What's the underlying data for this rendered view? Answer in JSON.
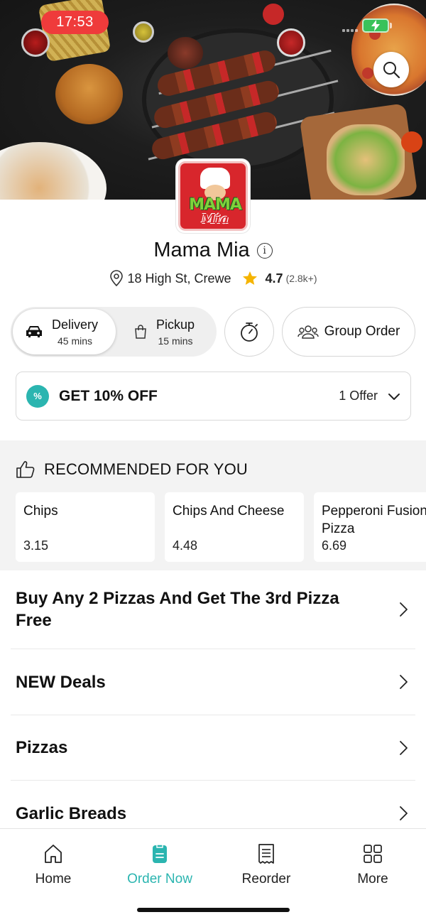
{
  "status_bar": {
    "time": "17:53"
  },
  "restaurant": {
    "name": "Mama Mia",
    "logo_text_1": "MAMA",
    "logo_text_2": "Mia",
    "address": "18 High St, Crewe",
    "rating": "4.7",
    "rating_count": "(2.8k+)"
  },
  "fulfilment": {
    "delivery": {
      "label": "Delivery",
      "time": "45 mins",
      "selected": true
    },
    "pickup": {
      "label": "Pickup",
      "time": "15 mins",
      "selected": false
    },
    "group_order_label": "Group Order"
  },
  "offer": {
    "title": "GET 10% OFF",
    "count": "1 Offer",
    "badge": "%"
  },
  "recommended": {
    "title": "RECOMMENDED FOR YOU",
    "items": [
      {
        "name": "Chips",
        "price": "3.15"
      },
      {
        "name": "Chips And Cheese",
        "price": "4.48"
      },
      {
        "name": "Pepperoni Fusion Pizza",
        "price": "6.69"
      }
    ]
  },
  "menu": [
    {
      "label": "Buy Any 2 Pizzas And Get The 3rd Pizza Free"
    },
    {
      "label": "NEW Deals"
    },
    {
      "label": "Pizzas"
    },
    {
      "label": "Garlic Breads"
    }
  ],
  "nav": [
    {
      "label": "Home",
      "icon": "home-icon",
      "active": false
    },
    {
      "label": "Order Now",
      "icon": "order-icon",
      "active": true
    },
    {
      "label": "Reorder",
      "icon": "receipt-icon",
      "active": false
    },
    {
      "label": "More",
      "icon": "grid-icon",
      "active": false
    }
  ],
  "colors": {
    "accent": "#2bb5b0",
    "time_pill": "#ef3b3b",
    "rating_star": "#f5b400",
    "logo_red": "#d8262c"
  }
}
